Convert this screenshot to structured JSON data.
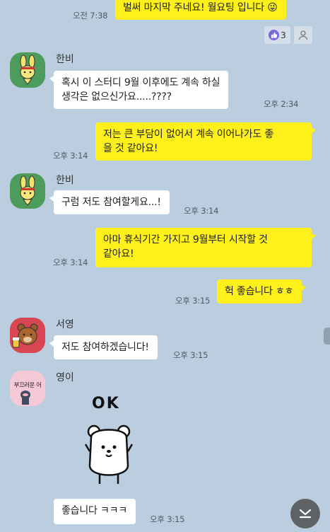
{
  "messages": {
    "m0": {
      "text": "벌써 마지막 주네요! 월요팅 입니다 ",
      "time": "오전 7:38",
      "emoji": "😜"
    },
    "m1": {
      "sender": "한비",
      "line1": "혹시 이 스터디 9월 이후에도 계속 하실",
      "line2": "생각은 없으신가요.....????",
      "time": "오후 2:34"
    },
    "m2": {
      "line1": "저는 큰 부담이 없어서 계속 이어나가도 좋",
      "line2": "을 것 같아요!",
      "time": "오후 3:14"
    },
    "m3": {
      "sender": "한비",
      "text": "구럼 저도 참여할게요...!",
      "time": "오후 3:14"
    },
    "m4": {
      "line1": "아마 휴식기간 가지고 9월부터 시작할 것",
      "line2": "같아요!",
      "time": "오후 3:14"
    },
    "m5": {
      "text": "헉 좋습니다 ㅎㅎ",
      "time": "오후 3:15"
    },
    "m6": {
      "sender": "서영",
      "text": "저도 참여하겠습니다!",
      "time": "오후 3:15"
    },
    "m7": {
      "sender": "영이",
      "sticker_text": "OK",
      "avatar_text": "부끄러운 어"
    },
    "m8": {
      "text": "좋습니다 ㅋㅋㅋ",
      "time": "오후 3:15"
    }
  },
  "reaction": {
    "count": "3"
  },
  "colors": {
    "background": "#bacee0",
    "mine": "#fef01b",
    "theirs": "#ffffff"
  }
}
